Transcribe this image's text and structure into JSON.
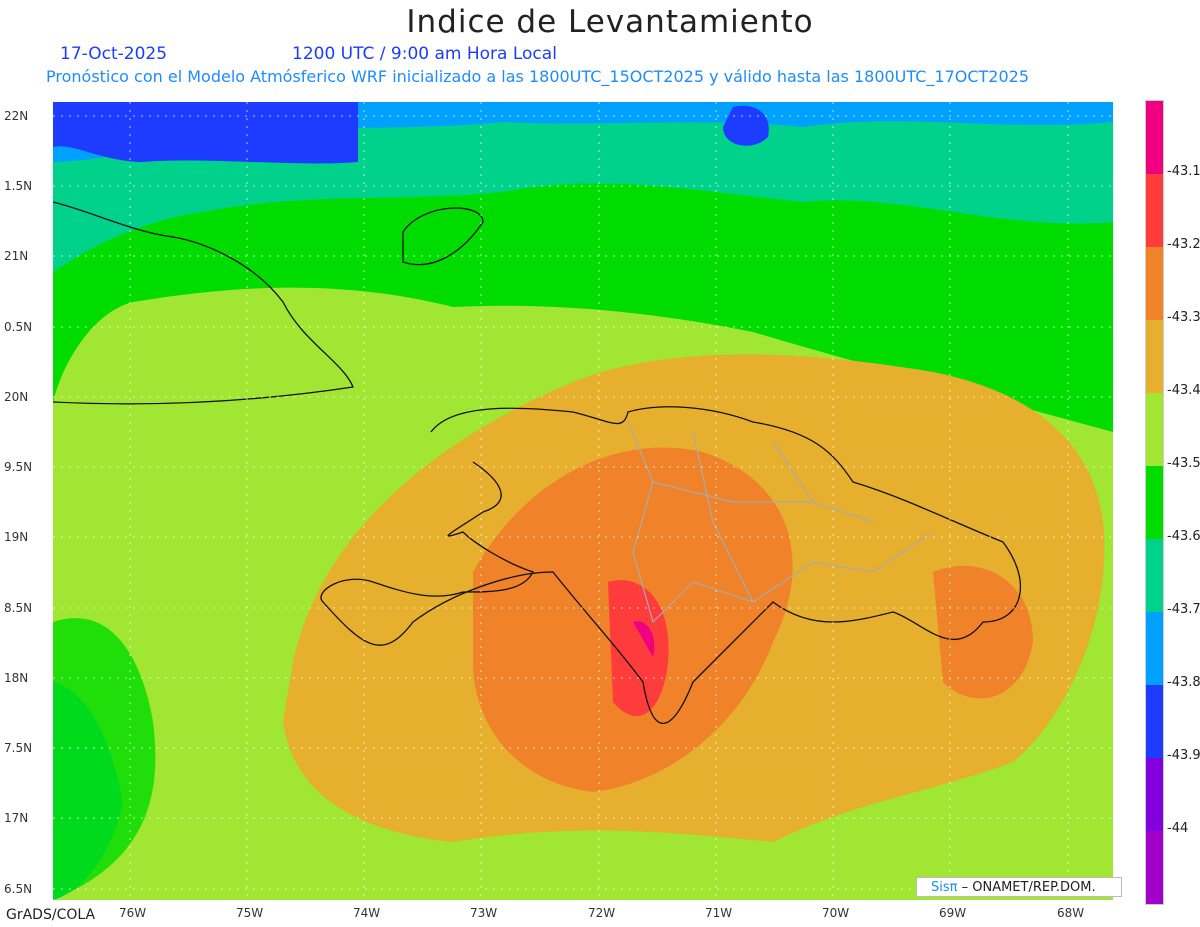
{
  "header": {
    "title": "Indice de Levantamiento",
    "date": "17-Oct-2025",
    "time": "1200 UTC / 9:00 am Hora Local",
    "subtitle": "Pronóstico con el Modelo Atmósferico WRF inicializado a las 1800UTC_15OCT2025 y válido hasta las  1800UTC_17OCT2025"
  },
  "axes": {
    "lat_labels": [
      "22N",
      "1.5N",
      "21N",
      "0.5N",
      "20N",
      "9.5N",
      "19N",
      "8.5N",
      "18N",
      "7.5N",
      "17N",
      "6.5N"
    ],
    "lon_labels": [
      "76W",
      "75W",
      "74W",
      "73W",
      "72W",
      "71W",
      "70W",
      "69W",
      "68W"
    ]
  },
  "colorbar": {
    "labels": [
      "-43.1",
      "-43.2",
      "-43.3",
      "-43.4",
      "-43.5",
      "-43.6",
      "-43.7",
      "-43.8",
      "-43.9",
      "-44"
    ],
    "colors": [
      "#f0007f",
      "#ff3c3c",
      "#f0822a",
      "#e6af2d",
      "#a0e632",
      "#00dc00",
      "#00d28c",
      "#00a0ff",
      "#1e3cff",
      "#8200dc",
      "#a000c8"
    ]
  },
  "credit": {
    "logo": "Sisπ",
    "text": "– ONAMET/REP.DOM."
  },
  "footer": "GrADS/COLA"
}
